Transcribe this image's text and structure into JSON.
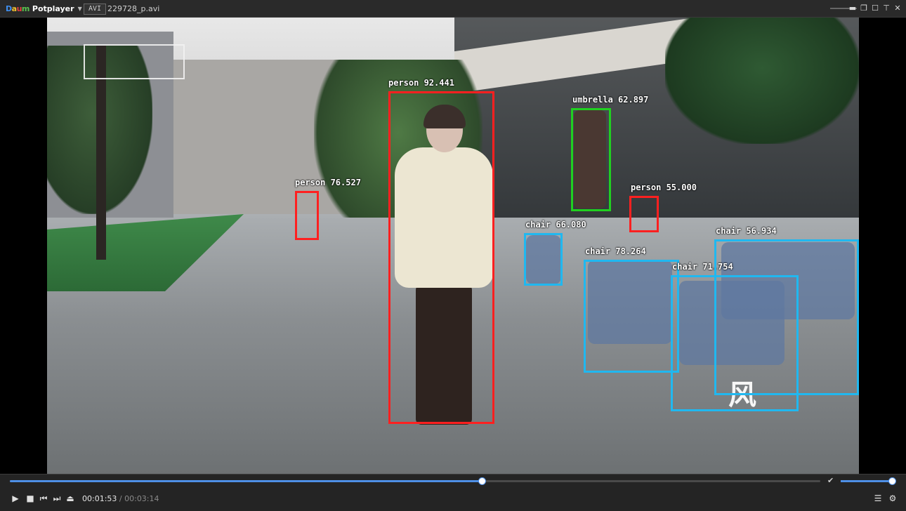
{
  "title_bar": {
    "app_name": "Potplayer",
    "logo_letters": [
      "D",
      "a",
      "u",
      "m"
    ],
    "format_badge": "AVI",
    "filename": "229728_p.avi",
    "window_buttons": {
      "minimize": "▬",
      "restore": "❐",
      "maximize": "☐",
      "close": "✕",
      "pin": "⊤"
    }
  },
  "video": {
    "detections": [
      {
        "label": "person 92.441",
        "color": "#ff2020",
        "class": "person"
      },
      {
        "label": "person 76.527",
        "color": "#ff2020",
        "class": "person"
      },
      {
        "label": "person 55.000",
        "color": "#ff2020",
        "class": "person"
      },
      {
        "label": "umbrella 62.897",
        "color": "#20d020",
        "class": "umbrella"
      },
      {
        "label": "chair 66.080",
        "color": "#20b8f0",
        "class": "chair"
      },
      {
        "label": "chair 78.264",
        "color": "#20b8f0",
        "class": "chair"
      },
      {
        "label": "chair 71.754",
        "color": "#20b8f0",
        "class": "chair"
      },
      {
        "label": "chair 56.934",
        "color": "#20b8f0",
        "class": "chair"
      }
    ],
    "watermark_right": "风"
  },
  "controls": {
    "current_time": "00:01:53",
    "separator": " / ",
    "total_time": "00:03:14",
    "seek_progress": 0.5826,
    "volume_level": 0.99,
    "icons": {
      "play": "▶",
      "stop": "■",
      "prev": "⏮",
      "next": "⏭",
      "eject": "⏏",
      "playlist": "☰",
      "settings": "⚙",
      "volume": "✔"
    }
  },
  "colors": {
    "accent": "#4e8fe6",
    "person_box": "#ff2020",
    "umbrella_box": "#20d020",
    "chair_box": "#20b8f0"
  }
}
